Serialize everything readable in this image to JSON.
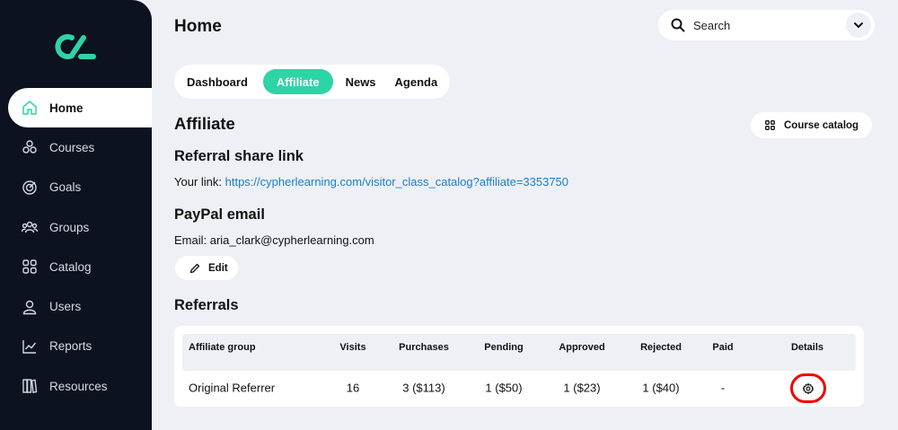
{
  "sidebar": {
    "items": [
      {
        "label": "Home",
        "icon": "home-icon"
      },
      {
        "label": "Courses",
        "icon": "courses-icon"
      },
      {
        "label": "Goals",
        "icon": "goals-icon"
      },
      {
        "label": "Groups",
        "icon": "groups-icon"
      },
      {
        "label": "Catalog",
        "icon": "catalog-icon"
      },
      {
        "label": "Users",
        "icon": "user-icon"
      },
      {
        "label": "Reports",
        "icon": "reports-icon"
      },
      {
        "label": "Resources",
        "icon": "resources-icon"
      }
    ],
    "active": "Home"
  },
  "header": {
    "title": "Home",
    "search_label": "Search"
  },
  "tabs": [
    {
      "label": "Dashboard"
    },
    {
      "label": "Affiliate"
    },
    {
      "label": "News"
    },
    {
      "label": "Agenda"
    }
  ],
  "active_tab": "Affiliate",
  "affiliate": {
    "title": "Affiliate",
    "course_catalog_label": "Course catalog",
    "referral_title": "Referral share link",
    "link_prefix": "Your link: ",
    "link_url": "https://cypherlearning.com/visitor_class_catalog?affiliate=3353750",
    "paypal_title": "PayPal email",
    "email_line": "Email: aria_clark@cypherlearning.com",
    "edit_label": "Edit",
    "referrals_title": "Referrals"
  },
  "referrals_table": {
    "headers": [
      "Affiliate group",
      "Visits",
      "Purchases",
      "Pending",
      "Approved",
      "Rejected",
      "Paid",
      "Details"
    ],
    "rows": [
      {
        "group": "Original Referrer",
        "visits": "16",
        "purchases": "3 ($113)",
        "pending": "1 ($50)",
        "approved": "1 ($23)",
        "rejected": "1 ($40)",
        "paid": "-",
        "details_icon": "gear-icon"
      }
    ]
  },
  "colors": {
    "sidebar_bg": "#0d1220",
    "accent": "#2dd4a6",
    "link": "#1b7fc9",
    "page_bg": "#eef0f5",
    "highlight": "#e00000"
  }
}
